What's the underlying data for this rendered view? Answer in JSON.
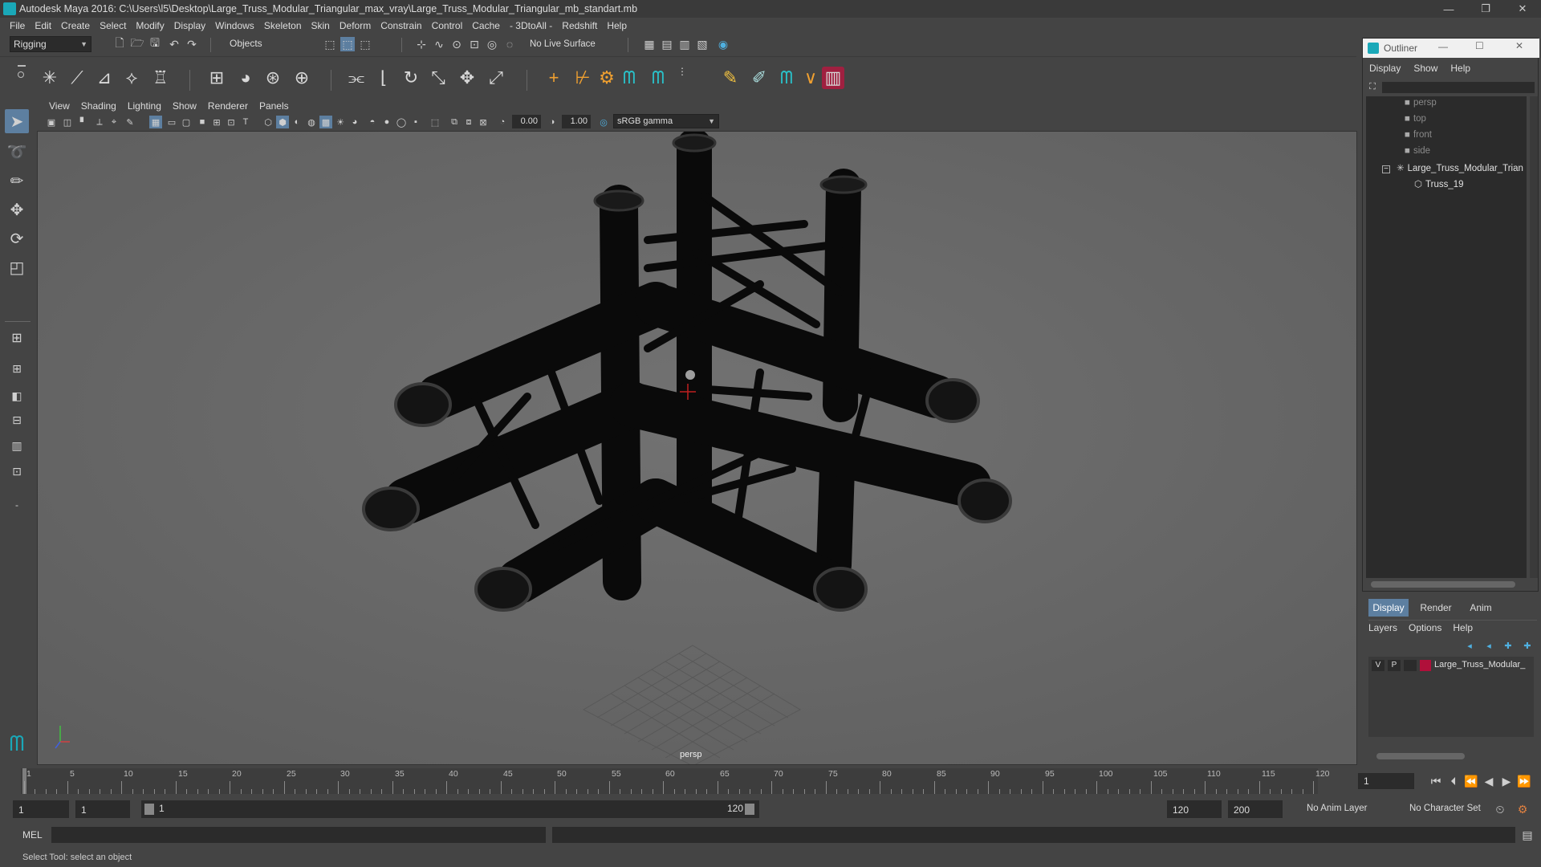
{
  "window": {
    "title": "Autodesk Maya 2016: C:\\Users\\l5\\Desktop\\Large_Truss_Modular_Triangular_max_vray\\Large_Truss_Modular_Triangular_mb_standart.mb",
    "minimize": "—",
    "restore": "❐",
    "close": "✕"
  },
  "menubar": [
    "File",
    "Edit",
    "Create",
    "Select",
    "Modify",
    "Display",
    "Windows",
    "Skeleton",
    "Skin",
    "Deform",
    "Constrain",
    "Control",
    "Cache",
    "- 3DtoAll -",
    "Redshift",
    "Help"
  ],
  "statusline": {
    "mode": "Rigging",
    "selection_mode": "Objects",
    "live_surface": "No Live Surface"
  },
  "panel": {
    "menus": [
      "View",
      "Shading",
      "Lighting",
      "Show",
      "Renderer",
      "Panels"
    ],
    "exposure": "0.00",
    "gamma": "1.00",
    "color_space": "sRGB gamma",
    "camera_label": "persp"
  },
  "timeline": {
    "ticks": [
      "1",
      "5",
      "10",
      "15",
      "20",
      "25",
      "30",
      "35",
      "40",
      "45",
      "50",
      "55",
      "60",
      "65",
      "70",
      "75",
      "80",
      "85",
      "90",
      "95",
      "100",
      "105",
      "110",
      "115",
      "120"
    ],
    "current_frame": "1"
  },
  "range": {
    "start": "1",
    "playback_start": "1",
    "slider_start": "1",
    "slider_end": "120",
    "playback_end": "120",
    "end": "200",
    "anim_layer": "No Anim Layer",
    "character_set": "No Character Set"
  },
  "cmdline": {
    "label": "MEL"
  },
  "helpline": {
    "text": "Select Tool: select an object"
  },
  "outliner": {
    "title": "Outliner",
    "menus": [
      "Display",
      "Show",
      "Help"
    ],
    "items": [
      {
        "label": "persp",
        "dim": true
      },
      {
        "label": "top",
        "dim": true
      },
      {
        "label": "front",
        "dim": true
      },
      {
        "label": "side",
        "dim": true
      },
      {
        "label": "Large_Truss_Modular_Trian",
        "dim": false
      },
      {
        "label": "Truss_19",
        "dim": false
      }
    ]
  },
  "layers": {
    "tabs": [
      "Display",
      "Render",
      "Anim"
    ],
    "menus": [
      "Layers",
      "Options",
      "Help"
    ],
    "row": {
      "v": "V",
      "p": "P",
      "name": "Large_Truss_Modular_",
      "color": "#b0103a"
    }
  },
  "colors": {
    "ui_bg": "#444444",
    "viewport_bg": "#6b6b6b",
    "active_blue": "#5d7fa0",
    "field_bg": "#2b2b2b"
  }
}
